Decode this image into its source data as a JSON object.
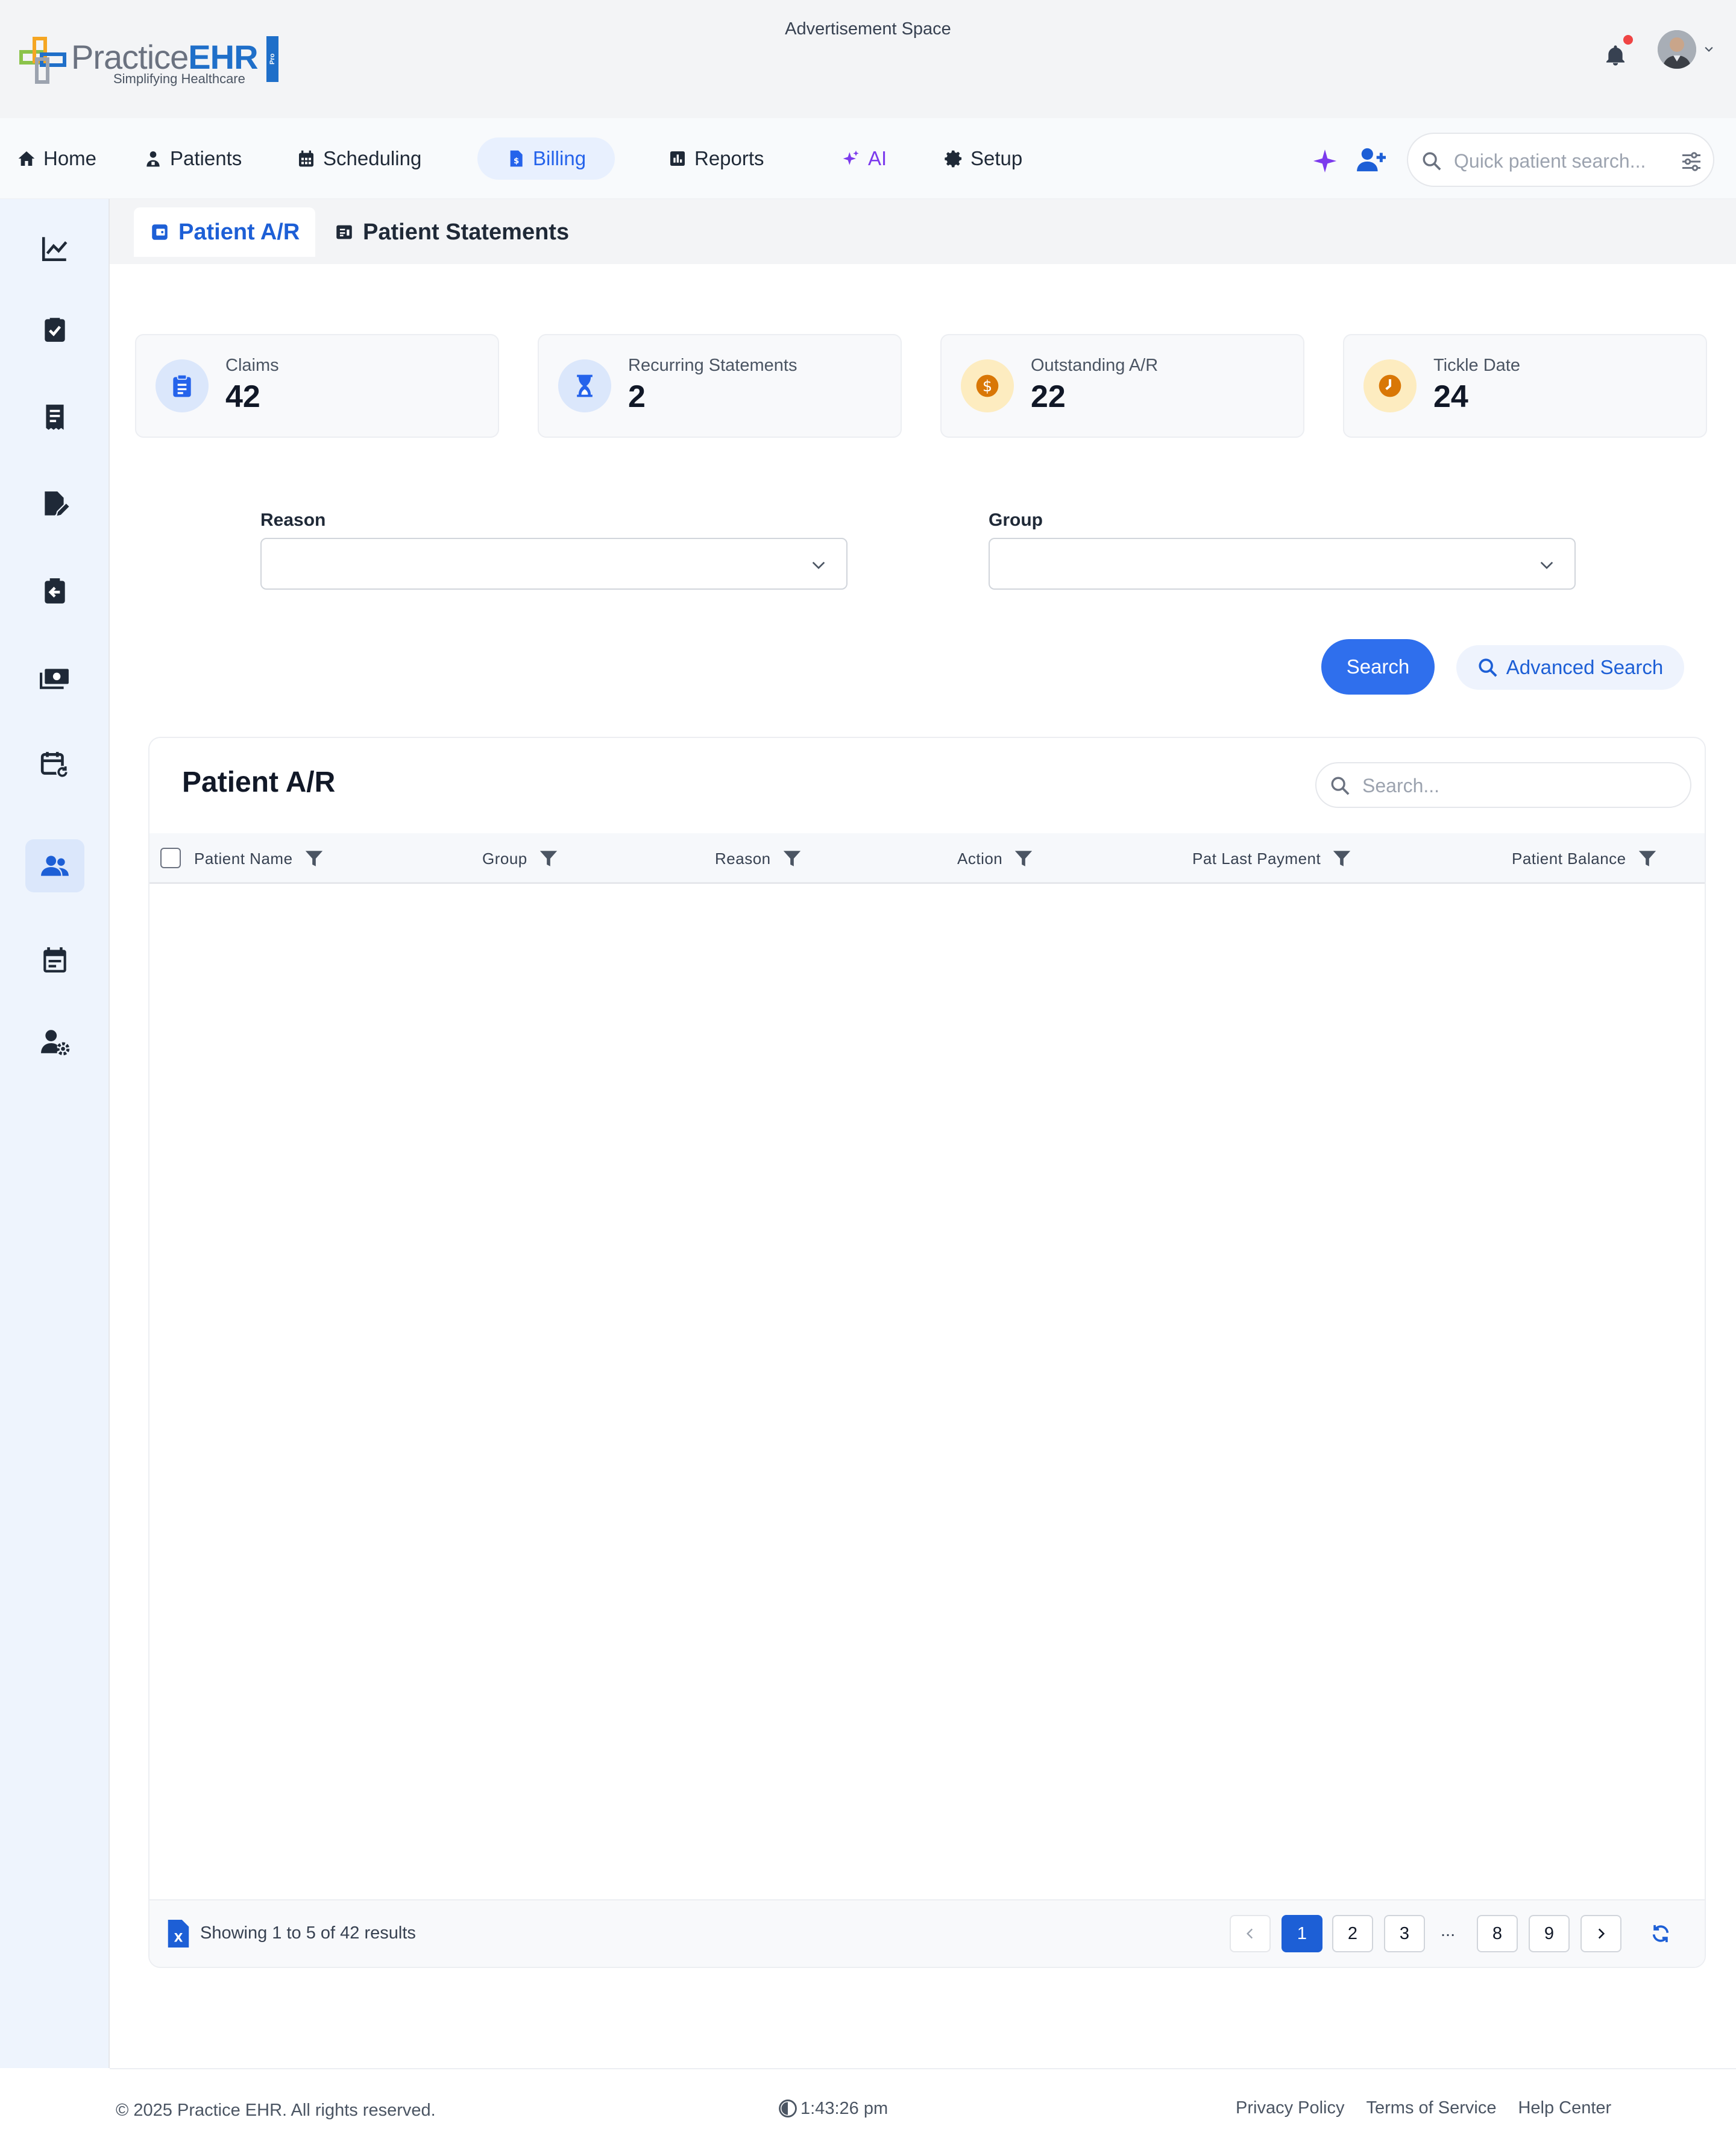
{
  "header": {
    "logo": {
      "text_light": "Practice",
      "text_bold": "EHR",
      "tagline": "Simplifying Healthcare",
      "badge": "Pro"
    },
    "ad_space": "Advertisement Space",
    "notification_dot_color": "#ef4444"
  },
  "nav": {
    "items": [
      {
        "label": "Home",
        "icon": "home-icon"
      },
      {
        "label": "Patients",
        "icon": "patient-icon"
      },
      {
        "label": "Scheduling",
        "icon": "calendar-icon"
      },
      {
        "label": "Billing",
        "icon": "billing-file-icon",
        "active": true
      },
      {
        "label": "Reports",
        "icon": "chart-bar-icon"
      },
      {
        "label": "AI",
        "icon": "sparkle-icon"
      },
      {
        "label": "Setup",
        "icon": "gear-icon"
      }
    ],
    "quick_search_placeholder": "Quick patient search..."
  },
  "sidebar": {
    "items": [
      {
        "icon": "line-chart-icon"
      },
      {
        "icon": "clipboard-check-icon"
      },
      {
        "icon": "receipt-icon"
      },
      {
        "icon": "file-edit-icon"
      },
      {
        "icon": "clipboard-return-icon"
      },
      {
        "icon": "money-icon"
      },
      {
        "icon": "calendar-refresh-icon"
      },
      {
        "icon": "users-icon",
        "active": true
      },
      {
        "icon": "calendar-list-icon"
      },
      {
        "icon": "user-gear-icon"
      }
    ]
  },
  "subtabs": [
    {
      "label": "Patient A/R",
      "active": true
    },
    {
      "label": "Patient Statements"
    }
  ],
  "stats": [
    {
      "label": "Claims",
      "value": "42",
      "icon": "clipboard-list-icon"
    },
    {
      "label": "Recurring Statements",
      "value": "2",
      "icon": "hourglass-icon"
    },
    {
      "label": "Outstanding A/R",
      "value": "22",
      "icon": "dollar-coin-icon"
    },
    {
      "label": "Tickle Date",
      "value": "24",
      "icon": "clock-icon"
    }
  ],
  "filters": {
    "reason_label": "Reason",
    "reason_value": "",
    "group_label": "Group",
    "group_value": "",
    "search_button": "Search",
    "advanced_search_button": "Advanced Search"
  },
  "table": {
    "title": "Patient A/R",
    "search_placeholder": "Search...",
    "columns": [
      "Patient Name",
      "Group",
      "Reason",
      "Action",
      "Pat Last Payment",
      "Patient Balance"
    ],
    "rows": [],
    "showing_text": "Showing 1 to 5 of 42 results",
    "pagination": {
      "pages": [
        "1",
        "2",
        "3",
        "...",
        "8",
        "9"
      ],
      "current": "1"
    }
  },
  "footer": {
    "copyright": "© 2025 Practice EHR. All rights reserved.",
    "time": "1:43:26 pm",
    "links": [
      "Privacy Policy",
      "Terms of Service",
      "Help Center"
    ]
  },
  "colors": {
    "primary": "#2f6fed",
    "accent_blue": "#1d5fd6",
    "ai_purple": "#7c3aed",
    "warning_orange": "#d97706"
  }
}
